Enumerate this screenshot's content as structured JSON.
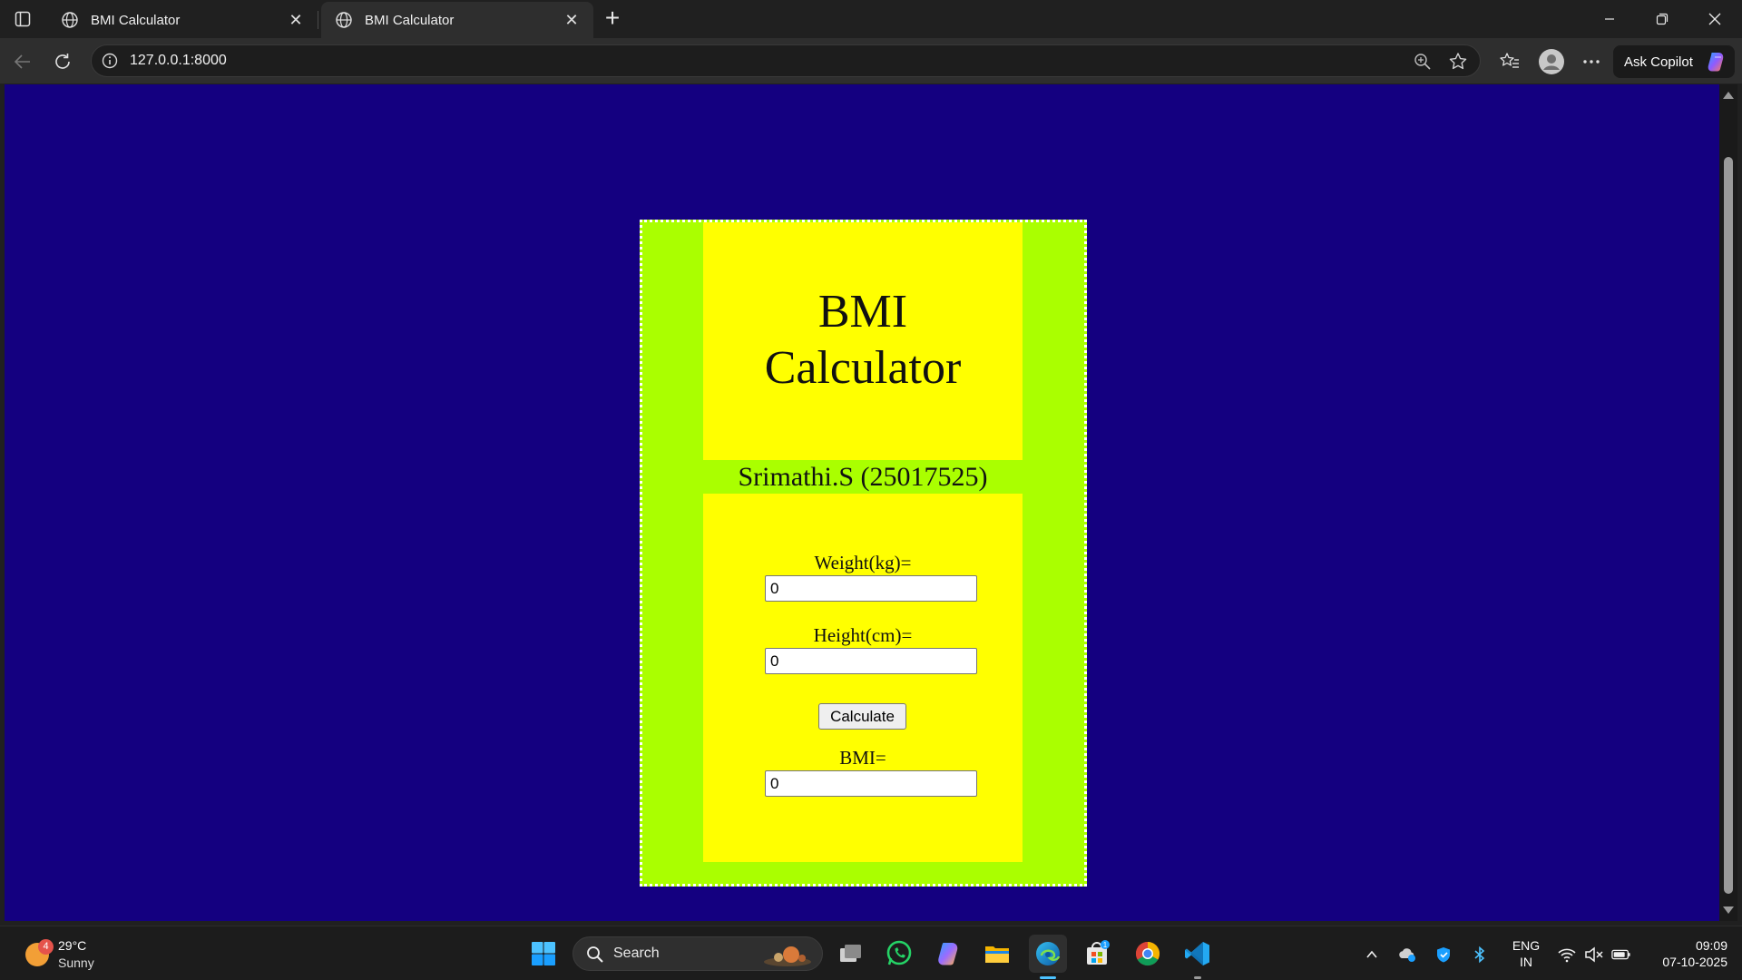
{
  "browser": {
    "tabs": [
      {
        "title": "BMI Calculator",
        "active": false
      },
      {
        "title": "BMI Calculator",
        "active": true
      }
    ],
    "url": "127.0.0.1:8000",
    "copilot_label": "Ask Copilot"
  },
  "page": {
    "title_line1": "BMI",
    "title_line2": "Calculator",
    "author": "Srimathi.S (25017525)",
    "weight_label": "Weight(kg)=",
    "weight_value": "0",
    "height_label": "Height(cm)=",
    "height_value": "0",
    "calculate_label": "Calculate",
    "bmi_label": "BMI=",
    "bmi_value": "0",
    "colors": {
      "background": "#140080",
      "outer_box": "#aaff00",
      "inner_box": "#ffff00"
    }
  },
  "taskbar": {
    "weather": {
      "temp": "29°C",
      "condition": "Sunny",
      "badge": "4"
    },
    "search_label": "Search",
    "apps": [
      "start-icon",
      "task-view-icon",
      "whatsapp-icon",
      "copilot-app-icon",
      "file-explorer-icon",
      "edge-icon",
      "store-icon",
      "chrome-icon",
      "vscode-icon"
    ],
    "store_badge": "1",
    "language": {
      "line1": "ENG",
      "line2": "IN"
    },
    "clock": {
      "time": "09:09",
      "date": "07-10-2025"
    }
  }
}
